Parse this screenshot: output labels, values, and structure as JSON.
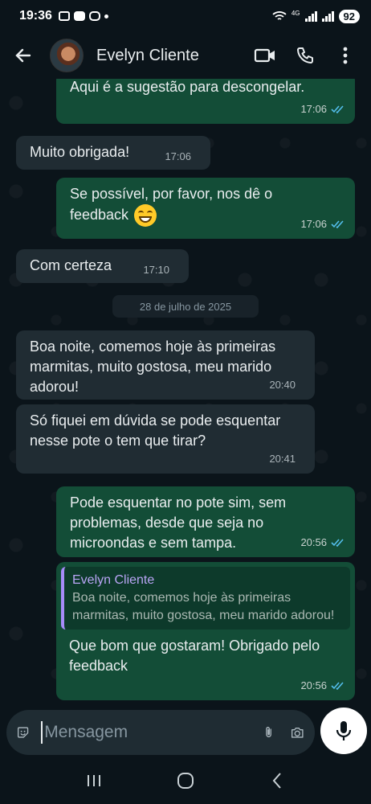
{
  "status_bar": {
    "time": "19:36",
    "network": "4G",
    "battery": "92"
  },
  "header": {
    "contact_name": "Evelyn Cliente"
  },
  "messages": [
    {
      "direction": "out",
      "text": "Aqui é a sugestão para descongelar.",
      "time": "17:06",
      "status": "read"
    },
    {
      "direction": "in",
      "text": "Muito obrigada!",
      "time": "17:06"
    },
    {
      "direction": "out",
      "text": "Se possível, por favor, nos dê o feedback",
      "emoji": "grinning-face",
      "time": "17:06",
      "status": "read"
    },
    {
      "direction": "in",
      "text": "Com certeza",
      "time": "17:10"
    },
    {
      "direction": "in",
      "text": "Boa noite, comemos hoje às primeiras marmitas, muito gostosa, meu marido adorou!",
      "time": "20:40"
    },
    {
      "direction": "in",
      "text": "Só fiquei em dúvida se pode esquentar nesse pote o tem que tirar?",
      "time": "20:41"
    },
    {
      "direction": "out",
      "text": "Pode esquentar no pote sim, sem problemas, desde que seja no microondas e sem tampa.",
      "time": "20:56",
      "status": "read"
    },
    {
      "direction": "out",
      "quote": {
        "author": "Evelyn Cliente",
        "text": "Boa noite, comemos hoje às primeiras marmitas, muito gostosa, meu marido adorou!"
      },
      "text": "Que bom que gostaram! Obrigado pelo feedback",
      "time": "20:56",
      "status": "read"
    }
  ],
  "date_separator": "28 de julho de 2025",
  "composer": {
    "placeholder": "Mensagem"
  },
  "colors": {
    "background": "#0b141a",
    "incoming_bubble": "#202c33",
    "outgoing_bubble": "#134d37",
    "read_ticks": "#53bdeb",
    "quote_accent": "#a78bfa"
  }
}
